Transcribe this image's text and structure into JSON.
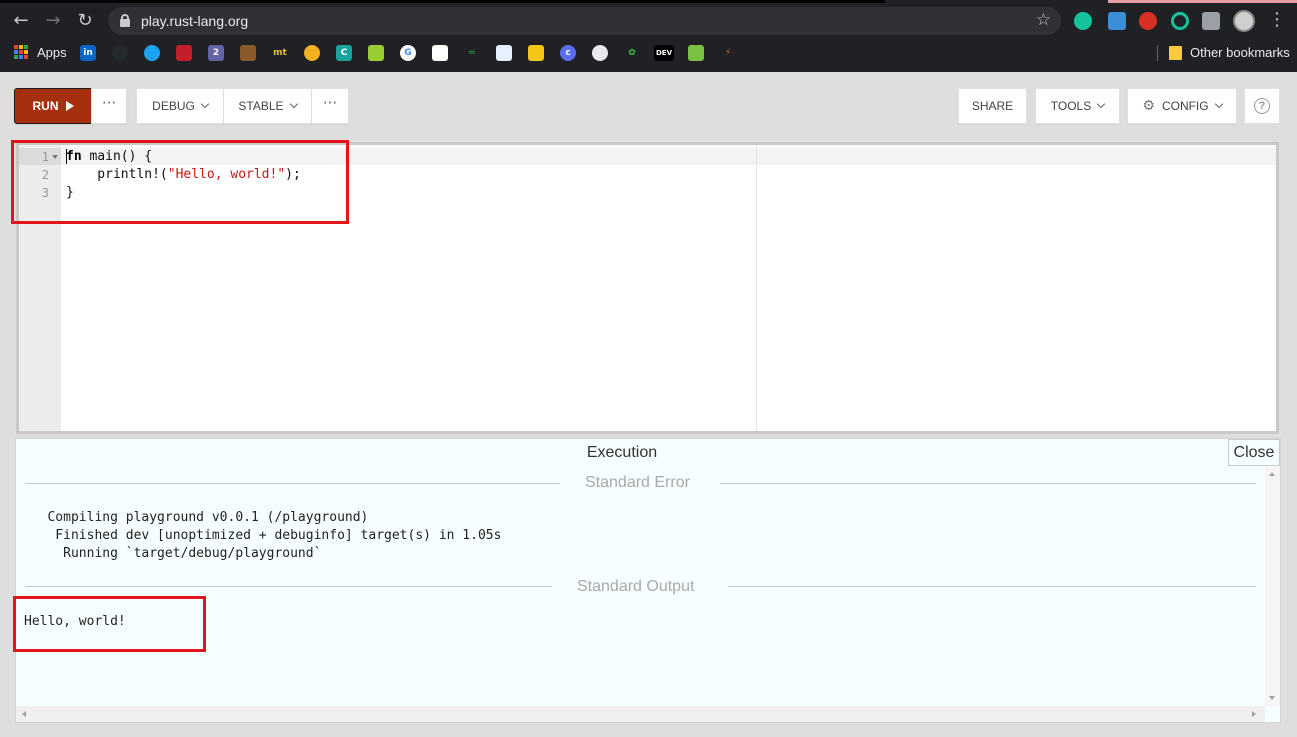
{
  "browser": {
    "url": "play.rust-lang.org",
    "apps_label": "Apps",
    "other_bookmarks_label": "Other bookmarks",
    "bookmark_icons": [
      "linkedin-icon",
      "github-icon",
      "twitter-icon",
      "codepen-icon",
      "calendar-icon",
      "tampermonkey-icon",
      "mt-icon",
      "emoji-icon",
      "c-icon",
      "book-icon",
      "google-icon",
      "trello-icon",
      "gfg-icon",
      "photo-icon",
      "lock-icon",
      "c-circle-icon",
      "globe-icon",
      "leaf-icon",
      "dev-icon",
      "cube-icon",
      "hackerrank-icon"
    ],
    "bookmark_texts": {
      "mt": "mt",
      "c": "C",
      "dev": "DEV",
      "google": "G"
    }
  },
  "toolbar": {
    "run_label": "RUN",
    "debug_label": "DEBUG",
    "stable_label": "STABLE",
    "share_label": "SHARE",
    "tools_label": "TOOLS",
    "config_label": "CONFIG",
    "more_label": "···"
  },
  "editor": {
    "line_numbers": [
      "1",
      "2",
      "3"
    ],
    "line1_kw": "fn",
    "line1_rest": " main() {",
    "line2_pre": "    println!(",
    "line2_str": "\"Hello, world!\"",
    "line2_post": ");",
    "line3": "}"
  },
  "output": {
    "title": "Execution",
    "close_label": "Close",
    "stderr_label": "Standard Error",
    "stderr_lines": [
      "   Compiling playground v0.0.1 (/playground)",
      "    Finished dev [unoptimized + debuginfo] target(s) in 1.05s",
      "     Running `target/debug/playground`"
    ],
    "stdout_label": "Standard Output",
    "stdout_text": "Hello, world!"
  },
  "colors": {
    "run_button": "#a52f0e",
    "annotation_red": "#e3141b",
    "string_literal": "#c41a16",
    "output_bg": "#f7feff"
  }
}
